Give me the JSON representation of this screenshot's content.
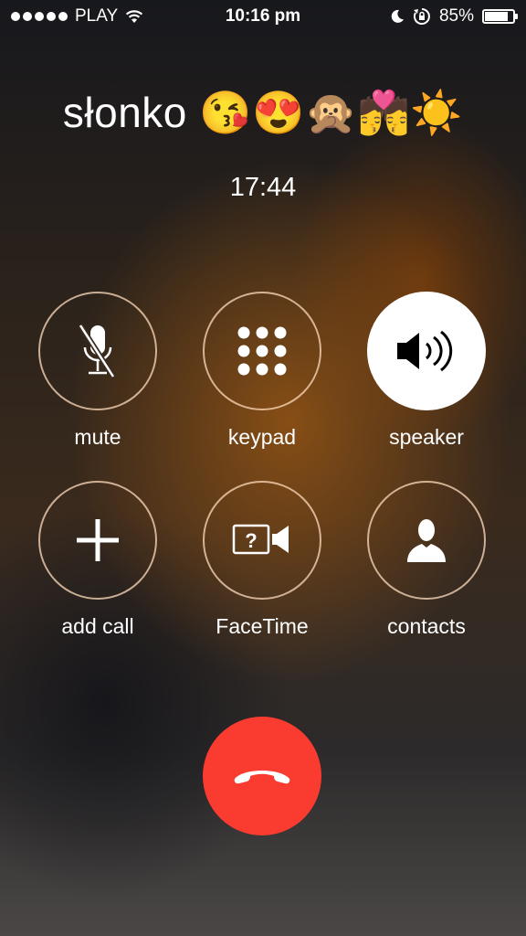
{
  "status_bar": {
    "carrier": "PLAY",
    "time": "10:16 pm",
    "battery_percent": "85%",
    "battery_level": 0.85,
    "icons": [
      "signal-dots-icon",
      "wifi-icon",
      "moon-icon",
      "rotation-lock-icon",
      "battery-icon"
    ]
  },
  "call": {
    "caller_name": "słonko 😘😍🙊💏☀️",
    "duration": "17:44"
  },
  "controls": {
    "mute": "mute",
    "keypad": "keypad",
    "speaker": "speaker",
    "add_call": "add call",
    "facetime": "FaceTime",
    "contacts": "contacts"
  },
  "states": {
    "speaker_active": true,
    "mute_enabled": false,
    "facetime_enabled": false
  },
  "colors": {
    "end_call": "#fa3b30",
    "active_button": "#ffffff"
  }
}
